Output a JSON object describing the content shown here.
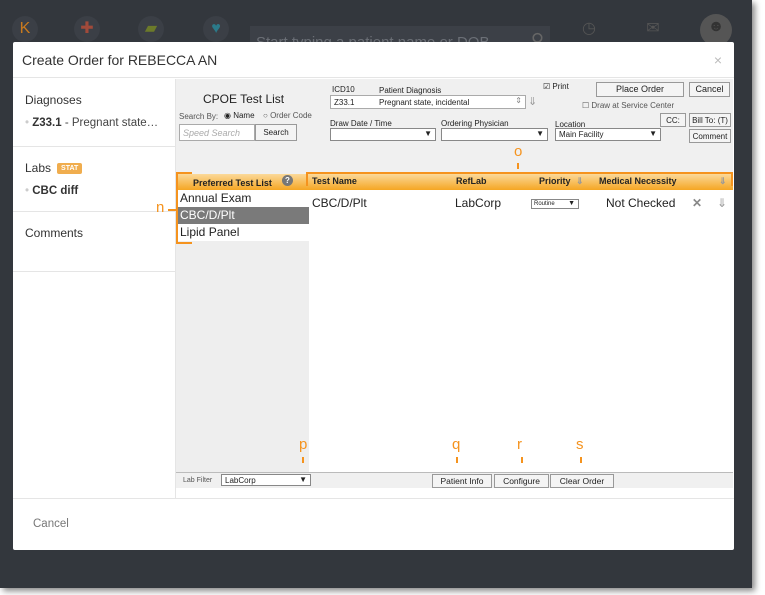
{
  "appbar": {
    "search_placeholder": "Start typing a patient name or DOB",
    "icons": [
      "kareo-logo-icon",
      "medical-cross-icon",
      "money-icon",
      "patient-heart-icon",
      "history-icon",
      "mail-icon",
      "avatar-icon"
    ]
  },
  "modal": {
    "title": "Create Order for REBECCA AN",
    "close": "×",
    "cancel": "Cancel"
  },
  "sidebar": {
    "diagnoses_title": "Diagnoses",
    "diagnosis_code": "Z33.1",
    "diagnosis_desc": " - Pregnant state…",
    "labs_title": "Labs",
    "stat_badge": "STAT",
    "lab_item": "CBC diff",
    "comments_title": "Comments"
  },
  "cpoe": {
    "title": "CPOE Test List",
    "search_by": "Search By:",
    "opt_name": "Name",
    "opt_code": "Order Code",
    "speed_placeholder": "Speed Search",
    "search_btn": "Search",
    "icd_label": "ICD10",
    "diag_label": "Patient Diagnosis",
    "icd_value": "Z33.1",
    "diag_value": "Pregnant state, incidental",
    "print_label": "Print",
    "print_checked": true,
    "draw_label": "Draw at Service Center",
    "place_order": "Place Order",
    "cancel": "Cancel",
    "draw_date_label": "Draw Date / Time",
    "physician_label": "Ordering Physician",
    "location_label": "Location",
    "location_value": "Main Facility",
    "cc_btn": "CC:",
    "billto_btn": "Bill To: (T)",
    "comment_btn": "Comment",
    "pref_header": "Preferred Test List",
    "columns": [
      "Test Name",
      "RefLab",
      "Priority",
      "Medical Necessity"
    ],
    "pref_items": [
      "Annual Exam",
      "CBC/D/Plt",
      "Lipid Panel"
    ],
    "pref_selected": "CBC/D/Plt",
    "rows": [
      {
        "test": "CBC/D/Plt",
        "reflab": "LabCorp",
        "priority": "Routine",
        "necessity": "Not Checked"
      }
    ],
    "lab_filter_label": "Lab Filter",
    "lab_filter_value": "LabCorp",
    "patient_info": "Patient Info",
    "configure": "Configure",
    "clear_order": "Clear Order"
  },
  "annotations": {
    "n": "n",
    "o": "o",
    "p": "p",
    "q": "q",
    "r": "r",
    "s": "s"
  },
  "colors": {
    "accent": "#f5931e",
    "header_gradient_end": "#f5a623"
  }
}
